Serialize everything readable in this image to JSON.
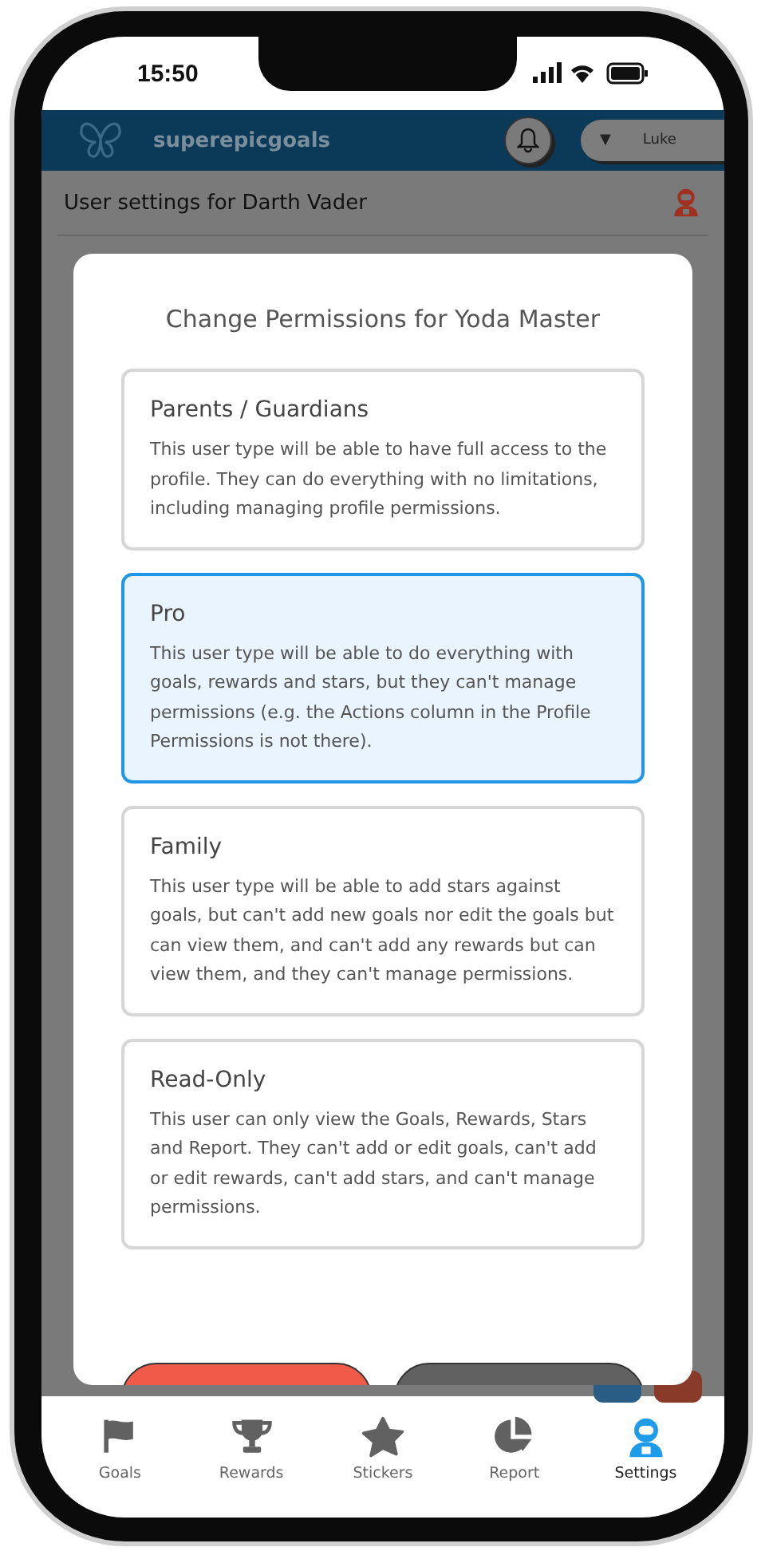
{
  "status_bar": {
    "time": "15:50"
  },
  "header": {
    "app_name": "superepicgoals",
    "user_menu": {
      "caret": "▼",
      "label": "Luke"
    }
  },
  "subheader": {
    "title": "User settings for Darth Vader"
  },
  "modal": {
    "title": "Change Permissions for Yoda Master",
    "options": [
      {
        "title": "Parents / Guardians",
        "description": "This user type will be able to have full access to the profile. They can do everything with no limitations, including managing profile permissions.",
        "selected": false
      },
      {
        "title": "Pro",
        "description": "This user type will be able to do everything with goals, rewards and stars, but they can't manage permissions (e.g. the Actions column in the Profile Permissions is not there).",
        "selected": true
      },
      {
        "title": "Family",
        "description": "This user type will be able to add stars against goals, but can't add new goals nor edit the goals but can view them, and can't add any rewards but can view them, and they can't manage permissions.",
        "selected": false
      },
      {
        "title": "Read-Only",
        "description": "This user can only view the Goals, Rewards, Stars and Report. They can't add or edit goals, can't add or edit rewards, can't add stars, and can't manage permissions.",
        "selected": false
      }
    ],
    "buttons": [
      {
        "kind": "confirm"
      },
      {
        "kind": "cancel"
      }
    ]
  },
  "bottom_nav": [
    {
      "kind": "goals",
      "label": "Goals",
      "selected": false
    },
    {
      "kind": "rewards",
      "label": "Rewards",
      "selected": false
    },
    {
      "kind": "stickers",
      "label": "Stickers",
      "selected": false
    },
    {
      "kind": "report",
      "label": "Report",
      "selected": false
    },
    {
      "kind": "settings",
      "label": "Settings",
      "selected": true
    }
  ]
}
